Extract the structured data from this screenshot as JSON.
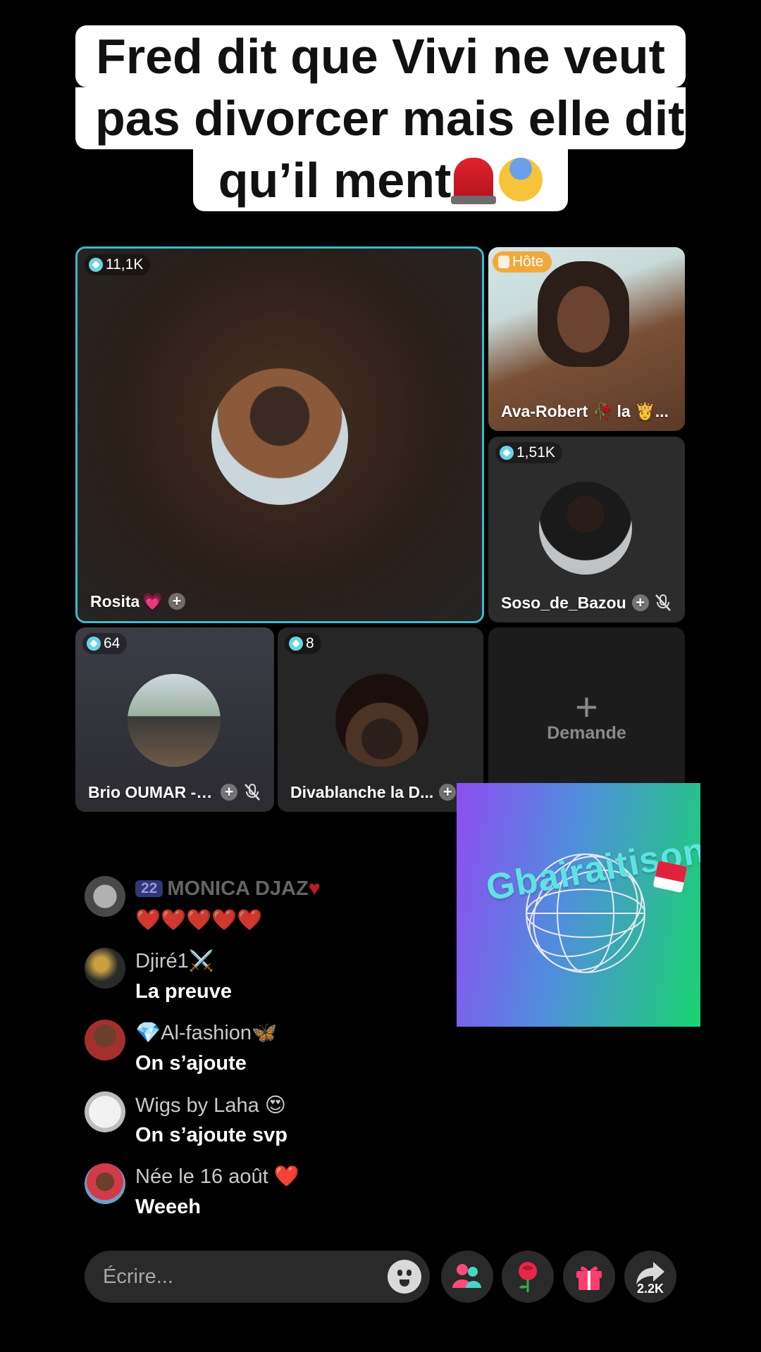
{
  "caption": {
    "line1": "Fred dit que Vivi ne veut",
    "line2": "pas divorcer mais elle dit",
    "line3": "qu’il ment"
  },
  "tiles": {
    "main": {
      "viewers": "11,1K",
      "name": "Rosita",
      "emoji": "💗"
    },
    "host": {
      "badge": "Hôte",
      "name": "Ava-Robert 🥀 la 👸..."
    },
    "soso": {
      "viewers": "1,51K",
      "name": "Soso_de_Bazou"
    },
    "brio": {
      "viewers": "64",
      "name": "Brio OUMAR - s..."
    },
    "diva": {
      "viewers": "8",
      "name": "Divablanche la D..."
    },
    "request": {
      "label": "Demande"
    }
  },
  "promo": {
    "title": "Gbairaitisons"
  },
  "chat": [
    {
      "level": "22",
      "user": "MONICA DJAZ",
      "text": "❤️❤️❤️❤️❤️"
    },
    {
      "user": "Djiré1⚔️",
      "text": "La preuve"
    },
    {
      "user": "💎Al-fashion🦋",
      "text": "On s’ajoute"
    },
    {
      "user": "Wigs by Laha 😍",
      "text": "On s’ajoute svp"
    },
    {
      "user": "Née le 16 août ❤️",
      "text": "Weeeh"
    }
  ],
  "bottom": {
    "placeholder": "Écrire...",
    "share_count": "2.2K"
  },
  "colors": {
    "accent_border": "#3fb7cf",
    "host_badge": "#f2a93b",
    "panel": "#2a2a2a"
  }
}
